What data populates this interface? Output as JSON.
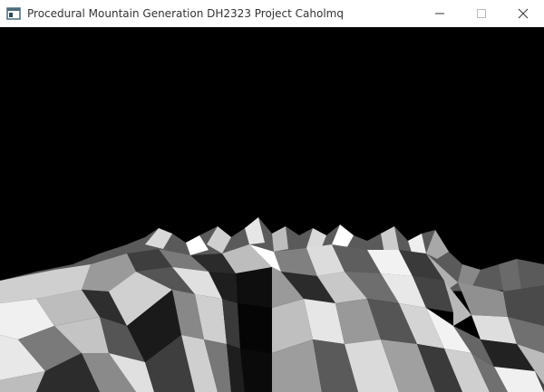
{
  "window": {
    "title": "Procedural Mountain Generation DH2323 Project Caholmq",
    "icon": "app-window-icon",
    "controls": [
      "minimize-icon",
      "maximize-icon",
      "close-icon"
    ]
  },
  "scene": {
    "background_color": "#000000",
    "description_colors": [
      "#ffffff",
      "#d9d9d9",
      "#bfbfbf",
      "#9a9a9a",
      "#6e6e6e",
      "#4a4a4a",
      "#262626"
    ]
  }
}
